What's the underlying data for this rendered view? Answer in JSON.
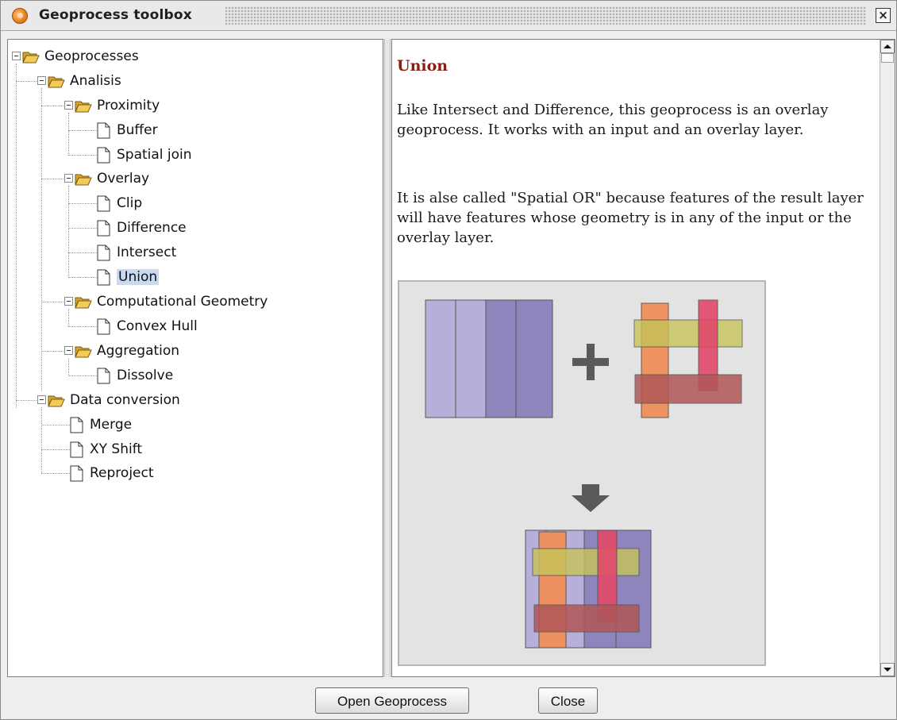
{
  "window": {
    "title": "Geoprocess toolbox"
  },
  "tree": {
    "root": "Geoprocesses",
    "analisis": "Analisis",
    "proximity": "Proximity",
    "buffer": "Buffer",
    "spatial_join": "Spatial join",
    "overlay": "Overlay",
    "clip": "Clip",
    "difference": "Difference",
    "intersect": "Intersect",
    "union": "Union",
    "computational_geometry": "Computational Geometry",
    "convex_hull": "Convex Hull",
    "aggregation": "Aggregation",
    "dissolve": "Dissolve",
    "data_conversion": "Data conversion",
    "merge": "Merge",
    "xy_shift": "XY Shift",
    "reproject": "Reproject",
    "selected": "Union"
  },
  "help": {
    "title": "Union",
    "para1": "Like Intersect and Difference, this geoprocess is an overlay geoprocess. It works with an input and an overlay layer.",
    "para2": "It is alse called \"Spatial OR\" because features of the result layer will have features whose geometry is in any of the input or the overlay layer."
  },
  "buttons": {
    "open": "Open Geoprocess",
    "close": "Close"
  },
  "colors": {
    "selection": "#c9daf0",
    "title_red": "#8c1c14",
    "input_light": "#b7aed9",
    "input_dark": "#8f85bd",
    "overlay_orange": "#f0905a",
    "overlay_olive": "#c7c45a",
    "overlay_pink": "#e04a6a",
    "overlay_brown": "#b05757"
  }
}
